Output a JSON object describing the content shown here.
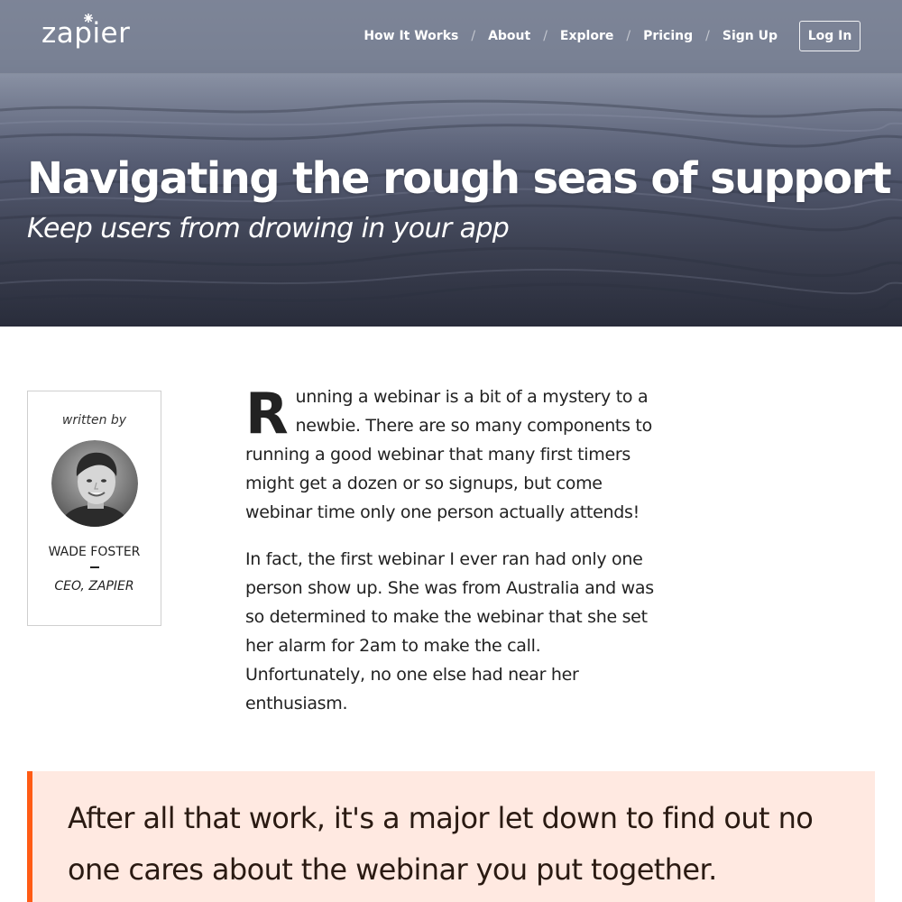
{
  "header": {
    "logo_text": "zapier",
    "nav": [
      {
        "label": "How It Works"
      },
      {
        "label": "About"
      },
      {
        "label": "Explore"
      },
      {
        "label": "Pricing"
      },
      {
        "label": "Sign Up"
      }
    ],
    "separator": "/",
    "login_label": "Log In"
  },
  "hero": {
    "title": "Navigating the rough seas of support",
    "subtitle": "Keep users from drowing in your app"
  },
  "author": {
    "written_by": "written by",
    "name": "WADE FOSTER",
    "role": "CEO, ZAPIER"
  },
  "article": {
    "dropcap": "R",
    "paragraph1_rest": "unning a webinar is a bit of a mystery to a newbie. There are so many components to running a good webinar that many first timers might get a dozen or so signups, but come webinar time only one person actually attends!",
    "paragraph2": "In fact, the first webinar I ever ran had only one person show up. She was from Australia and was so determined to make the webinar that she set her alarm for 2am to make the call. Unfortunately, no one else had near her enthusiasm."
  },
  "pullquote": {
    "text": "After all that work, it's a major let down to find out no one cares about the webinar you put together."
  },
  "colors": {
    "accent": "#ff5b14",
    "quote_bg": "#ffe9e1",
    "hero_dark": "#2e3240"
  },
  "icons": [
    "zapier-star-icon",
    "author-photo"
  ]
}
